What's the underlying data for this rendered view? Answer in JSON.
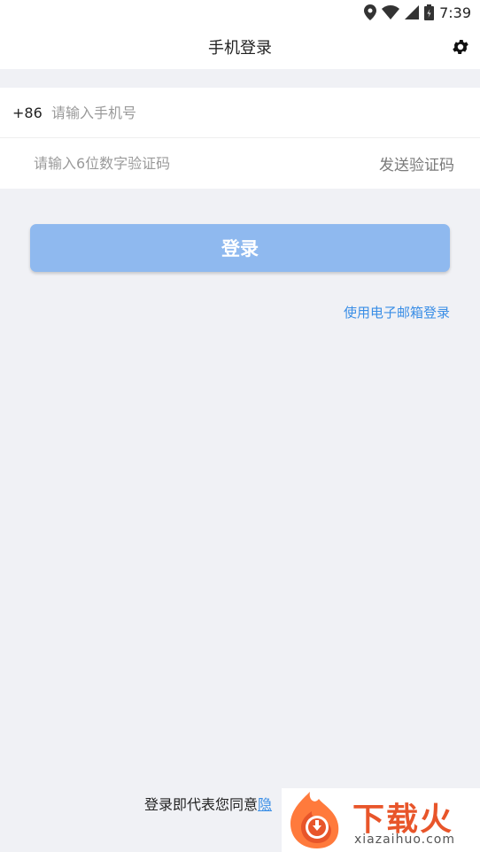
{
  "status_bar": {
    "time": "7:39",
    "icons": [
      "location-icon",
      "wifi-icon",
      "signal-icon",
      "battery-icon"
    ]
  },
  "app_bar": {
    "title": "手机登录",
    "settings_icon": "gear-icon"
  },
  "form": {
    "country_code": "+86",
    "phone_placeholder": "请输入手机号",
    "phone_value": "",
    "code_placeholder": "请输入6位数字验证码",
    "code_value": "",
    "send_code_label": "发送验证码"
  },
  "login_button_label": "登录",
  "email_login_label": "使用电子邮箱登录",
  "footer": {
    "agree_text": "登录即代表您同意",
    "policy_link_visible": "隐"
  },
  "watermark": {
    "title": "下载火",
    "url": "xiazaihuo.com"
  },
  "colors": {
    "accent": "#3a8ee6",
    "button": "#8fb9ef",
    "background": "#f0f1f5",
    "watermark": "#e8552a"
  }
}
